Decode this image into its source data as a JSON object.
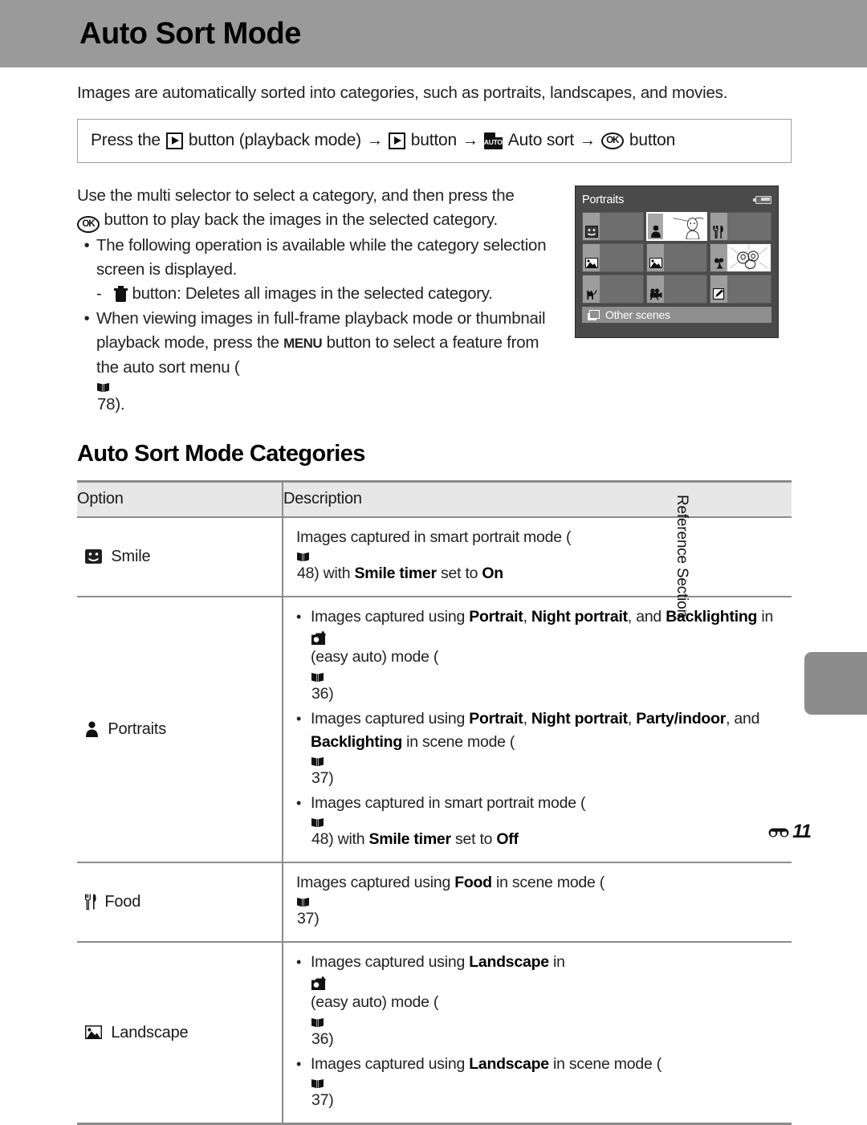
{
  "header": {
    "title": "Auto Sort Mode",
    "band_color": "#9a9a9a"
  },
  "intro": "Images are automatically sorted into categories, such as portraits, landscapes, and movies.",
  "procedure": {
    "part1": "Press the",
    "part2": "button (playback mode)",
    "arrow": "→",
    "part3": "button",
    "part4": "Auto sort",
    "part5": "button",
    "icons": {
      "playback": "playback-icon",
      "auto_sort": "auto-sort-folder-icon",
      "ok": "OK"
    }
  },
  "body": {
    "line1": "Use the multi selector to select a category, and then press the",
    "line2": "button to play back the images in the selected category.",
    "bullet1": "The following operation is available while the category selection screen is displayed.",
    "subbullet1_dash": "-",
    "subbullet1": "button: Deletes all images in the selected category.",
    "bullet2_a": "When viewing images in full-frame playback mode or thumbnail playback mode, press the",
    "bullet2_menu": "MENU",
    "bullet2_b": "button to select a feature from the auto sort menu (",
    "bullet2_page": "78",
    "bullet2_c": ")."
  },
  "lcd": {
    "title": "Portraits",
    "battery": "battery-icon",
    "other_scenes": "Other scenes",
    "cells": [
      {
        "icon": "smile-icon",
        "selected": false
      },
      {
        "icon": "portrait-icon",
        "selected": true
      },
      {
        "icon": "food-icon",
        "selected": false
      },
      {
        "icon": "landscape-icon",
        "selected": false
      },
      {
        "icon": "landscape-icon",
        "selected": false
      },
      {
        "icon": "close-up-flower-icon",
        "selected": false
      },
      {
        "icon": "pet-icon",
        "selected": false
      },
      {
        "icon": "movie-icon",
        "selected": false
      },
      {
        "icon": "retouch-icon",
        "selected": false
      }
    ]
  },
  "section_heading": "Auto Sort Mode Categories",
  "table": {
    "headers": {
      "option": "Option",
      "description": "Description"
    },
    "rows": [
      {
        "icon": "smile-icon",
        "option": "Smile",
        "bullets": false,
        "text_parts": [
          {
            "t": "Images captured in smart portrait mode (",
            "b": false
          },
          {
            "t": "BOOK",
            "b": false
          },
          {
            "t": " 48) with ",
            "b": false
          },
          {
            "t": "Smile timer",
            "b": true
          },
          {
            "t": " set to ",
            "b": false
          },
          {
            "t": "On",
            "b": true
          }
        ]
      },
      {
        "icon": "portrait-icon",
        "option": "Portraits",
        "bullets": true,
        "items": [
          "Images captured using Portrait, Night portrait, and Backlighting in (easy auto) mode (36)",
          "Images captured using Portrait, Night portrait, Party/indoor, and Backlighting in scene mode (37)",
          "Images captured in smart portrait mode (48) with Smile timer set to Off"
        ]
      },
      {
        "icon": "food-icon",
        "option": "Food",
        "bullets": false,
        "text": "Images captured using Food in scene mode (37)"
      },
      {
        "icon": "landscape-icon",
        "option": "Landscape",
        "bullets": true,
        "items": [
          "Images captured using Landscape in (easy auto) mode (36)",
          "Images captured using Landscape in scene mode (37)"
        ]
      }
    ],
    "page_refs": {
      "smart_portrait": "48",
      "easy_auto": "36",
      "scene_mode": "37"
    }
  },
  "side_tab": {
    "label": "Reference Section"
  },
  "footer": {
    "marker": "E",
    "page_number": "11"
  }
}
